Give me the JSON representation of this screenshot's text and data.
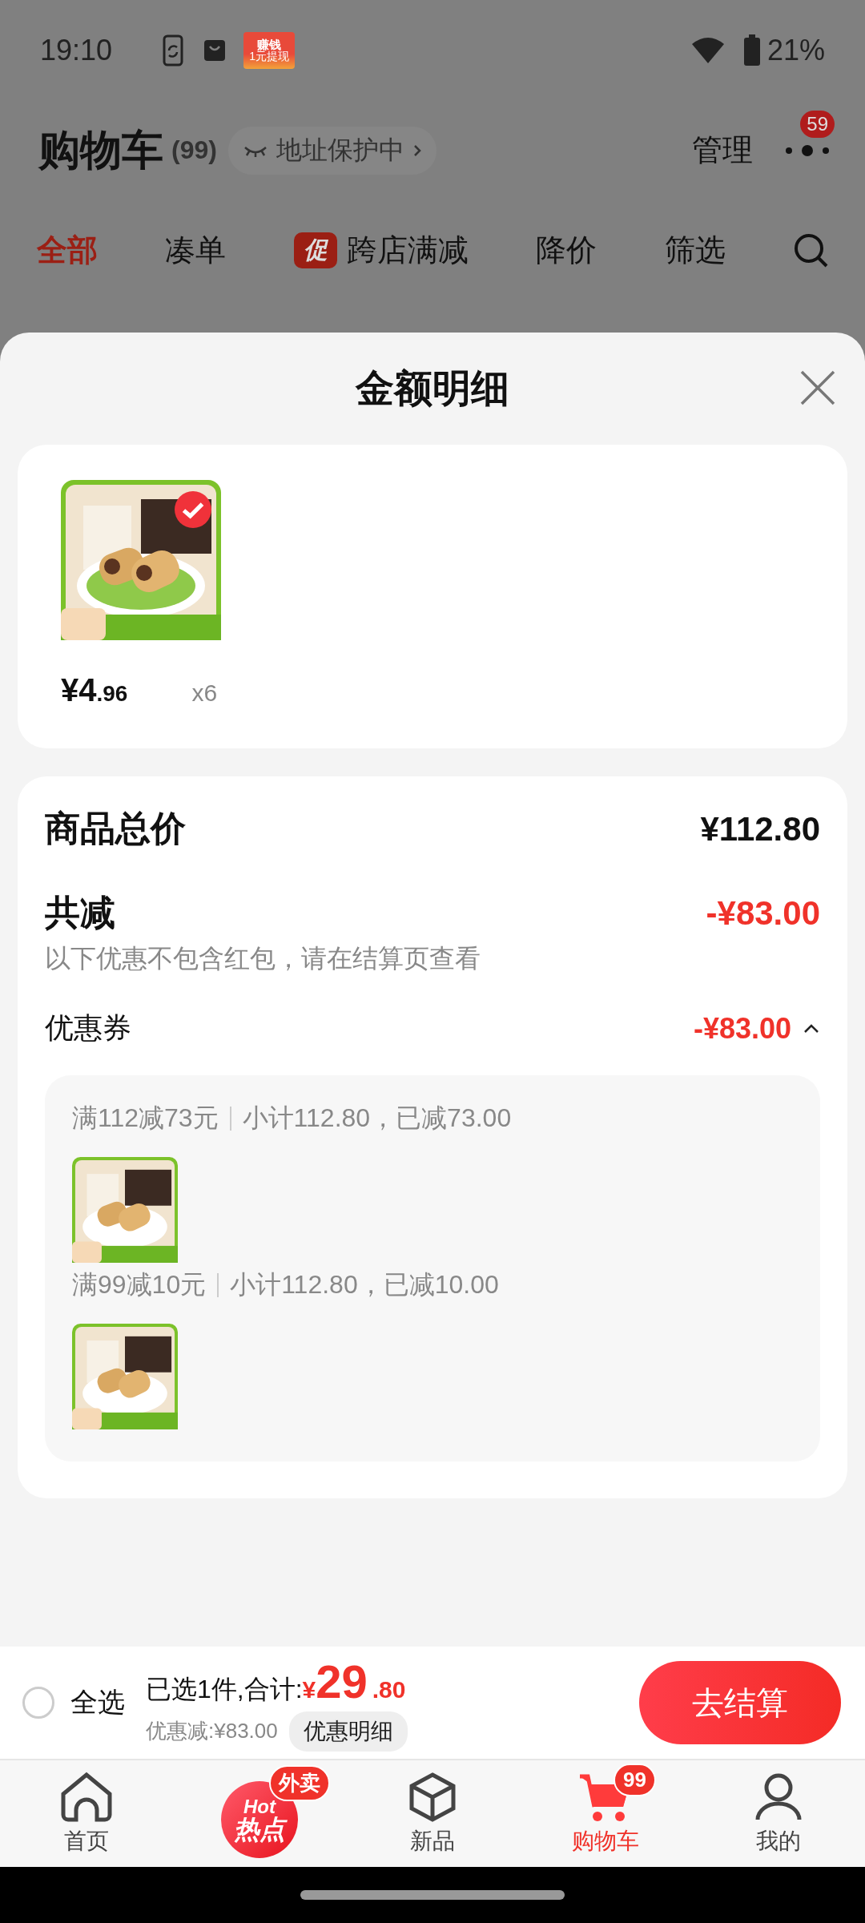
{
  "status_bar": {
    "time": "19:10",
    "app_badge": {
      "title": "赚钱",
      "subtitle": "1元提现"
    },
    "battery": "21%"
  },
  "header": {
    "title": "购物车",
    "count": "(99)",
    "address_pill": "地址保护中",
    "manage": "管理",
    "more_badge": "59"
  },
  "tabs": [
    {
      "label": "全部",
      "selected": true
    },
    {
      "label": "凑单",
      "selected": false
    },
    {
      "label": "跨店满减",
      "tag": "促",
      "selected": false
    },
    {
      "label": "降价",
      "selected": false
    },
    {
      "label": "筛选",
      "selected": false
    }
  ],
  "sheet": {
    "title": "金额明细",
    "items": [
      {
        "checked": true,
        "price_main": "¥4",
        "price_decimal": ".96",
        "quantity": "x6"
      }
    ],
    "summary": {
      "total_label": "商品总价",
      "total_value": "¥112.80",
      "discount_label": "共减",
      "discount_value": "-¥83.00",
      "discount_note": "以下优惠不包含红包，请在结算页查看",
      "coupon_label": "优惠券",
      "coupon_value": "-¥83.00",
      "coupon_expanded": true,
      "coupons": [
        {
          "rule": "满112减73元",
          "detail": "小计112.80，已减73.00"
        },
        {
          "rule": "满99减10元",
          "detail": "小计112.80，已减10.00"
        }
      ]
    }
  },
  "checkout_bar": {
    "select_all_checked": false,
    "select_all_label": "全选",
    "selected_text": "已选1件,合计:",
    "currency": "¥",
    "total_main": "29",
    "total_decimal": ".80",
    "saving": "优惠减:¥83.00",
    "detail_button": "优惠明细",
    "checkout_button": "去结算"
  },
  "nav": [
    {
      "kind": "home",
      "label": "首页",
      "selected": false
    },
    {
      "kind": "hot",
      "logo_top": "Hot",
      "logo_bottom": "热点",
      "badge": "外卖",
      "selected": false
    },
    {
      "kind": "box",
      "label": "新品",
      "selected": false
    },
    {
      "kind": "cart",
      "label": "购物车",
      "badge": "99",
      "selected": true
    },
    {
      "kind": "profile",
      "label": "我的",
      "selected": false
    }
  ]
}
